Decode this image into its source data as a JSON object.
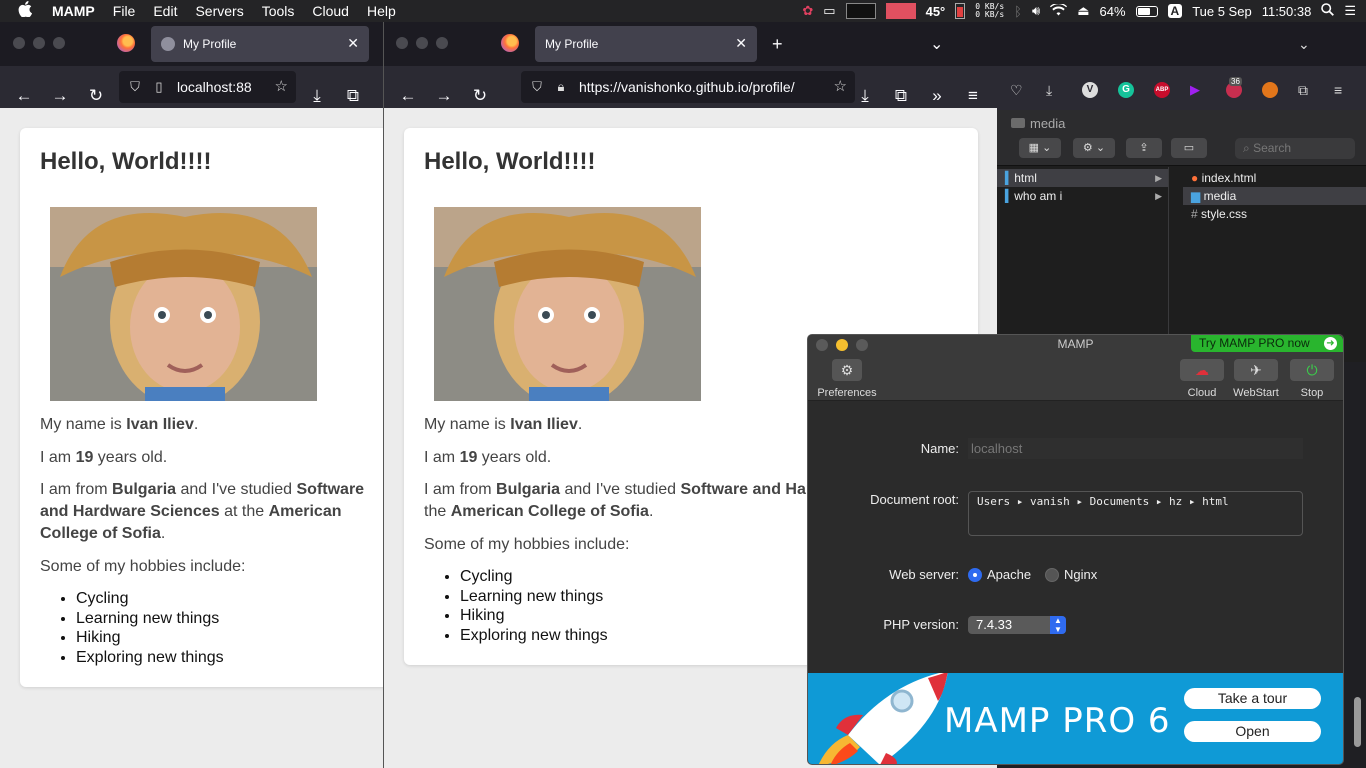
{
  "menubar": {
    "apple": "",
    "items": [
      "MAMP",
      "File",
      "Edit",
      "Servers",
      "Tools",
      "Cloud",
      "Help"
    ],
    "status": {
      "net_up": "0 KB/s",
      "net_down": "0 KB/s",
      "temp": "45°",
      "battery": "64%",
      "input_source": "A",
      "date": "Tue 5 Sep",
      "time": "11:50:38"
    }
  },
  "browser_left": {
    "tab_title": "My Profile",
    "url": "localhost:88",
    "page": {
      "heading": "Hello, World!!!!",
      "name_pre": "My name is ",
      "name": "Ivan Iliev",
      "name_post": ".",
      "age_pre": "I am ",
      "age": "19",
      "age_post": " years old.",
      "from_pre": "I am from ",
      "country": "Bulgaria",
      "from_mid": " and I've studied ",
      "field": "Software and Hardware Sciences",
      "from_at": " at the ",
      "college": "American College of Sofia",
      "from_end": ".",
      "hobbies_intro": "Some of my hobbies include:",
      "hobbies": [
        "Cycling",
        "Learning new things",
        "Hiking",
        "Exploring new things"
      ]
    }
  },
  "browser_right": {
    "tab_title": "My Profile",
    "url": "https://vanishonko.github.io/profile/"
  },
  "finder": {
    "path_title": "media",
    "search_placeholder": "Search",
    "col1": [
      "html",
      "who am i"
    ],
    "col2": [
      "index.html",
      "media",
      "style.css"
    ],
    "badge": "36"
  },
  "mamp": {
    "title": "MAMP",
    "try_pro": "Try MAMP PRO now",
    "toolbar": {
      "preferences": "Preferences",
      "cloud": "Cloud",
      "webstart": "WebStart",
      "stop": "Stop"
    },
    "labels": {
      "name": "Name:",
      "document_root": "Document root:",
      "web_server": "Web server:",
      "php_version": "PHP version:"
    },
    "name_placeholder": "localhost",
    "document_root": "Users ▸ vanish ▸ Documents ▸ hz ▸ html",
    "web_server_options": [
      "Apache",
      "Nginx"
    ],
    "web_server_selected": "Apache",
    "php_version": "7.4.33",
    "banner": {
      "product": "MAMP PRO 6",
      "tour": "Take a tour",
      "open": "Open"
    }
  },
  "colors": {
    "accent_blue": "#2f6bf0",
    "try_pro_green": "#29b52e",
    "banner_blue": "#0f9ad6"
  }
}
